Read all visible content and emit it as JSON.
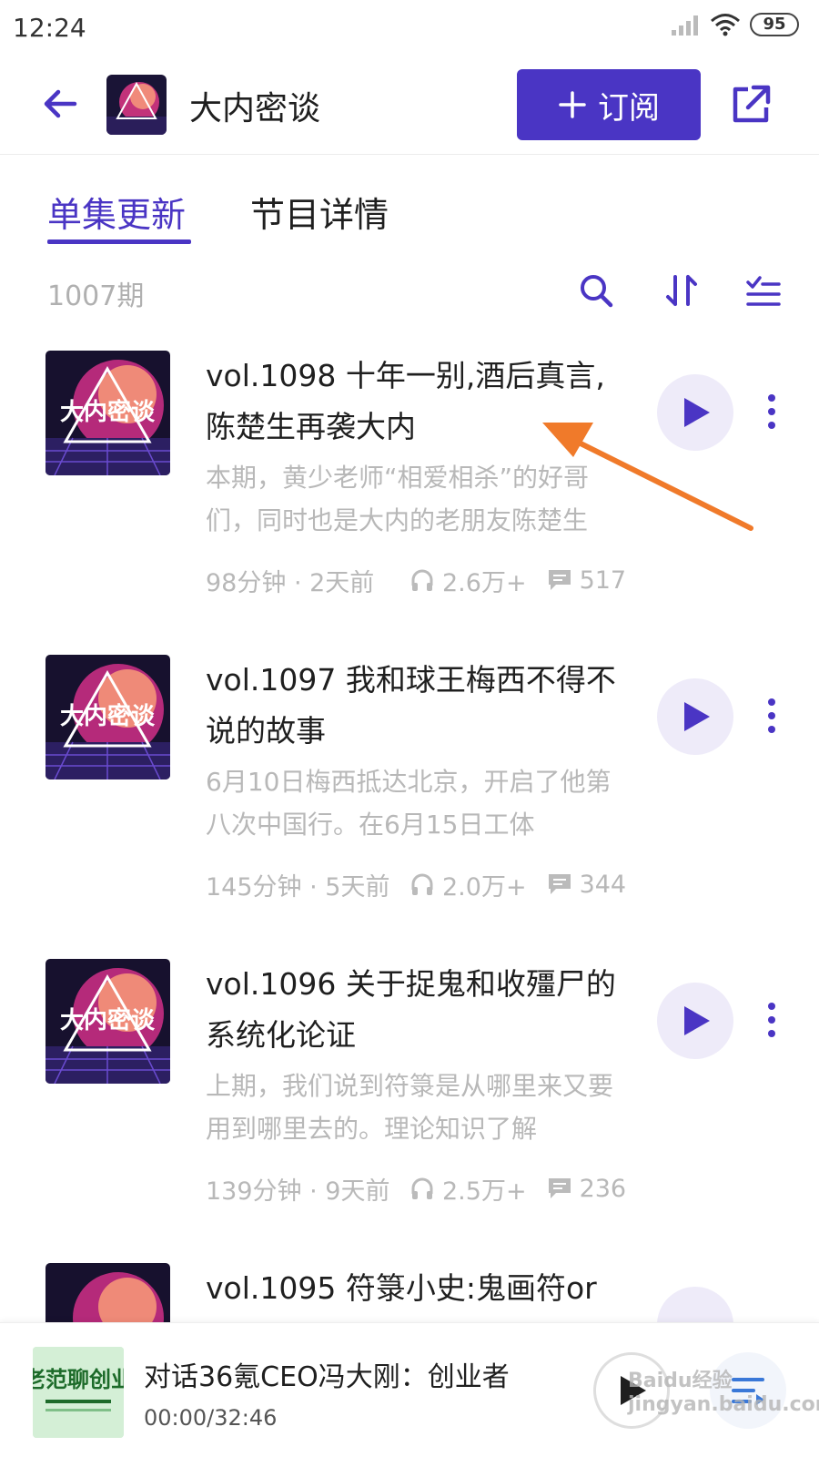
{
  "status_bar": {
    "time": "12:24",
    "battery": "95"
  },
  "header": {
    "title": "大内密谈",
    "subscribe_label": "订阅",
    "cover_text": "大内密谈"
  },
  "tabs": [
    {
      "label": "单集更新",
      "active": true
    },
    {
      "label": "节目详情",
      "active": false
    }
  ],
  "toolbar": {
    "episode_count": "1007期"
  },
  "episodes": [
    {
      "title": "vol.1098 十年一别,酒后真言,陈楚生再袭大内",
      "description": "本期，黄少老师“相爱相杀”的好哥们，同时也是大内的老朋友陈楚生",
      "duration": "98分钟 · 2天前",
      "plays": "2.6万+",
      "comments": "517"
    },
    {
      "title": "vol.1097 我和球王梅西不得不说的故事",
      "description": "6月10日梅西抵达北京，开启了他第八次中国行。在6月15日工体",
      "duration": "145分钟 · 5天前",
      "plays": "2.0万+",
      "comments": "344"
    },
    {
      "title": "vol.1096 关于捉鬼和收殭尸的系统化论证",
      "description": "上期，我们说到符箓是从哪里来又要用到哪里去的。理论知识了解",
      "duration": "139分钟 · 9天前",
      "plays": "2.5万+",
      "comments": "236"
    },
    {
      "title": "vol.1095 符箓小史:鬼画符or",
      "description": "",
      "duration": "",
      "plays": "",
      "comments": ""
    }
  ],
  "player": {
    "title": "对话36氪CEO冯大刚：创业者",
    "time": "00:00/32:46",
    "cover_text": "老范聊创业"
  },
  "watermark": "Baidu经验 jingyan.baidu.com",
  "colors": {
    "accent": "#4a35c4",
    "play_bg": "#eeebf9",
    "arrow": "#f07a2a"
  }
}
